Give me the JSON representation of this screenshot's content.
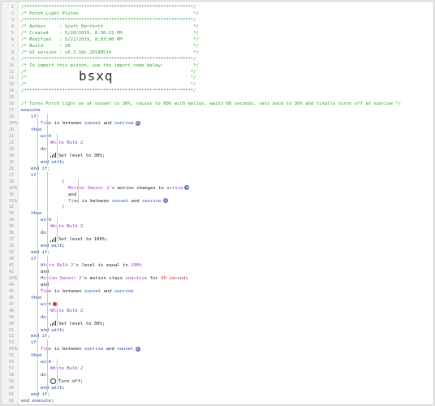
{
  "piston_code": "bsxq",
  "lines": [
    {
      "n": "1",
      "t": "/**************************************************************/",
      "c": "cm"
    },
    {
      "n": "2",
      "t": "/* Porch Light Piston                                          */",
      "c": "cm"
    },
    {
      "n": "3",
      "t": "/**************************************************************/",
      "c": "cm"
    },
    {
      "n": "4",
      "t": "/* Author     : Scott Herforth                                 */",
      "c": "cm"
    },
    {
      "n": "5",
      "t": "/* Created    : 5/20/2019, 8:30:22 PM                          */",
      "c": "cm"
    },
    {
      "n": "6",
      "t": "/* Modified   : 5/22/2019, 8:03:00 PM                          */",
      "c": "cm"
    },
    {
      "n": "7",
      "t": "/* Build      : 20                                             */",
      "c": "cm"
    },
    {
      "n": "8",
      "t": "/* UI version : v0.3.10c.20190514                              */",
      "c": "cm"
    },
    {
      "n": "9",
      "t": "/**************************************************************/",
      "c": "cm"
    },
    {
      "n": "10",
      "t": "/* To import this piston, use the import code below:           */",
      "c": "cm"
    },
    {
      "n": "11",
      "t": "/*                                                            */",
      "c": "cm"
    },
    {
      "n": "12",
      "t": "/*                                                            */",
      "c": "cm"
    },
    {
      "n": "13",
      "t": "/*                                                            */",
      "c": "cm"
    },
    {
      "n": "14",
      "t": "/**************************************************************/",
      "c": "cm"
    },
    {
      "n": "15",
      "t": "",
      "c": "cm"
    },
    {
      "n": "16",
      "t": "/* Turns Porch light on at sunset to 30%, raises to 80% with motion, waits 60 seconds, sets back to 30% and finally turns off at sunrise */",
      "c": "cm"
    },
    {
      "n": "17",
      "t": "execute",
      "c": "kw",
      "x": 0
    },
    {
      "n": "18",
      "t": "if",
      "c": "kw",
      "x": 12
    },
    {
      "n": "19",
      "t": "",
      "c": "txt",
      "x": 24,
      "m": "%",
      "rich": "time1"
    },
    {
      "n": "20",
      "t": "then",
      "c": "kw",
      "x": 12
    },
    {
      "n": "21",
      "t": "with",
      "c": "kw",
      "x": 24
    },
    {
      "n": "22",
      "t": "White Bulb 2",
      "c": "dev",
      "x": 36
    },
    {
      "n": "23",
      "t": "do",
      "c": "kw",
      "x": 24
    },
    {
      "n": "24",
      "t": "Set level to 30%;",
      "c": "txt",
      "x": 36,
      "icon": "sig"
    },
    {
      "n": "25",
      "t": "end with;",
      "c": "kw",
      "x": 24
    },
    {
      "n": "26",
      "t": "end if;",
      "c": "kw",
      "x": 12
    },
    {
      "n": "27",
      "t": "if",
      "c": "kw",
      "x": 12
    },
    {
      "n": "28",
      "t": "(",
      "c": "txt",
      "x": 50
    },
    {
      "n": "29",
      "t": "",
      "c": "txt",
      "x": 58,
      "m": "%",
      "rich": "motion1"
    },
    {
      "n": "30",
      "t": "and",
      "c": "txt",
      "x": 58
    },
    {
      "n": "31",
      "t": "",
      "c": "txt",
      "x": 58,
      "m": "%",
      "rich": "time1"
    },
    {
      "n": "32",
      "t": ")",
      "c": "txt",
      "x": 50
    },
    {
      "n": "33",
      "t": "then",
      "c": "kw",
      "x": 12
    },
    {
      "n": "34",
      "t": "with",
      "c": "kw",
      "x": 24
    },
    {
      "n": "35",
      "t": "White Bulb 2",
      "c": "dev",
      "x": 36
    },
    {
      "n": "36",
      "t": "do",
      "c": "kw",
      "x": 24
    },
    {
      "n": "37",
      "t": "Set level to 100%;",
      "c": "txt",
      "x": 36,
      "icon": "sig"
    },
    {
      "n": "38",
      "t": "end with;",
      "c": "kw",
      "x": 24
    },
    {
      "n": "39",
      "t": "end if;",
      "c": "kw",
      "x": 12
    },
    {
      "n": "40",
      "t": "if",
      "c": "kw",
      "x": 12
    },
    {
      "n": "41",
      "t": "",
      "c": "txt",
      "x": 24,
      "rich": "level"
    },
    {
      "n": "42",
      "t": "and",
      "c": "txt",
      "x": 24
    },
    {
      "n": "43",
      "t": "",
      "c": "txt",
      "x": 24,
      "m": "%",
      "rich": "motion2"
    },
    {
      "n": "44",
      "t": "and",
      "c": "txt",
      "x": 24
    },
    {
      "n": "45",
      "t": "",
      "c": "txt",
      "x": 24,
      "rich": "time2"
    },
    {
      "n": "46",
      "t": "then",
      "c": "kw",
      "x": 12
    },
    {
      "n": "47",
      "t": "with",
      "c": "kw",
      "x": 24,
      "icon": "blk"
    },
    {
      "n": "48",
      "t": "White Bulb 2",
      "c": "dev",
      "x": 36
    },
    {
      "n": "49",
      "t": "do",
      "c": "kw",
      "x": 24
    },
    {
      "n": "50",
      "t": "Set level to 30%;",
      "c": "txt",
      "x": 36,
      "icon": "sig"
    },
    {
      "n": "51",
      "t": "end with;",
      "c": "kw",
      "x": 24
    },
    {
      "n": "52",
      "t": "end if;",
      "c": "kw",
      "x": 12
    },
    {
      "n": "53",
      "t": "if",
      "c": "kw",
      "x": 12
    },
    {
      "n": "54",
      "t": "",
      "c": "txt",
      "x": 24,
      "m": "%",
      "rich": "time3"
    },
    {
      "n": "55",
      "t": "then",
      "c": "kw",
      "x": 12
    },
    {
      "n": "56",
      "t": "with",
      "c": "kw",
      "x": 24
    },
    {
      "n": "57",
      "t": "White Bulb 2",
      "c": "dev",
      "x": 36
    },
    {
      "n": "58",
      "t": "do",
      "c": "kw",
      "x": 24
    },
    {
      "n": "59",
      "t": "Turn off;",
      "c": "txt",
      "x": 36,
      "icon": "pwr"
    },
    {
      "n": "60",
      "t": "end with;",
      "c": "kw",
      "x": 24
    },
    {
      "n": "61",
      "t": "end if;",
      "c": "kw",
      "x": 12
    },
    {
      "n": "62",
      "t": "end execute;",
      "c": "kw",
      "x": 0
    }
  ],
  "rich": {
    "time1": [
      [
        "Time",
        "dev"
      ],
      [
        " is between ",
        "txt"
      ],
      [
        "sunset",
        "var"
      ],
      [
        " and ",
        "txt"
      ],
      [
        "sunrise",
        "var"
      ]
    ],
    "motion1": [
      [
        "Motion Sensor 2",
        "dev"
      ],
      [
        "'s motion changes to ",
        "txt"
      ],
      [
        "active",
        "dev"
      ]
    ],
    "level": [
      [
        "White Bulb 2",
        "dev"
      ],
      [
        "'s level is equal to ",
        "txt"
      ],
      [
        "100%",
        "dev"
      ]
    ],
    "motion2": [
      [
        "Motion Sensor 2",
        "dev"
      ],
      [
        "'s motion stays ",
        "txt"
      ],
      [
        "inactive",
        "dev"
      ],
      [
        " for ",
        "txt"
      ],
      [
        "90 seconds",
        "red"
      ]
    ],
    "time2": [
      [
        "Time",
        "dev"
      ],
      [
        " is between ",
        "txt"
      ],
      [
        "sunset",
        "var"
      ],
      [
        " and ",
        "txt"
      ],
      [
        "sunrise",
        "var"
      ]
    ],
    "time3": [
      [
        "Time",
        "dev"
      ],
      [
        " is between ",
        "txt"
      ],
      [
        "sunrise",
        "var"
      ],
      [
        " and ",
        "txt"
      ],
      [
        "sunset",
        "var"
      ]
    ]
  },
  "colors": {
    "comment": "#2e9c2e",
    "keyword": "#1f3f8f",
    "device": "#9b38c8",
    "variable": "#2050c0",
    "marker": "#e8791b"
  }
}
